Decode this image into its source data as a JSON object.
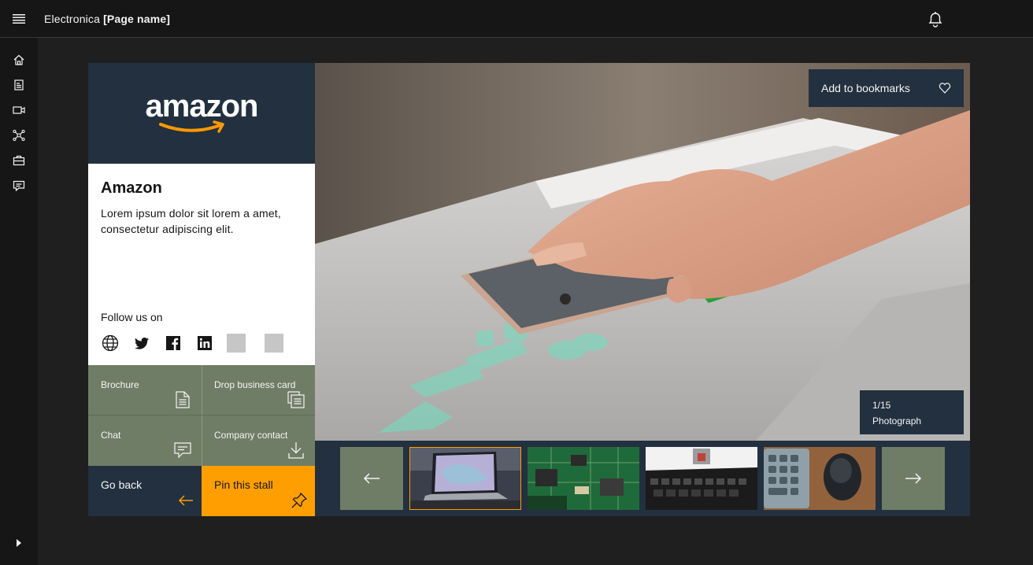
{
  "header": {
    "app_name": "Electronica",
    "page_name": "[Page name]"
  },
  "sidenav": {
    "items": [
      "home-icon",
      "document-icon",
      "video-icon",
      "network-icon",
      "briefcase-icon",
      "chat-icon"
    ]
  },
  "company": {
    "logo_text": "amazon",
    "name": "Amazon",
    "description": "Lorem ipsum dolor sit lorem a amet, consectetur adipiscing elit.",
    "follow_label": "Follow us on"
  },
  "actions": {
    "brochure": "Brochure",
    "drop_card": "Drop business card",
    "chat": "Chat",
    "company_contact": "Company contact",
    "go_back": "Go back",
    "pin_stall": "Pin this stall"
  },
  "gallery": {
    "bookmark_label": "Add to bookmarks",
    "counter": "1/15",
    "caption": "Photograph"
  },
  "colors": {
    "accent": "#ff9e00",
    "navy": "#22303f",
    "tile_green": "#707d66"
  }
}
